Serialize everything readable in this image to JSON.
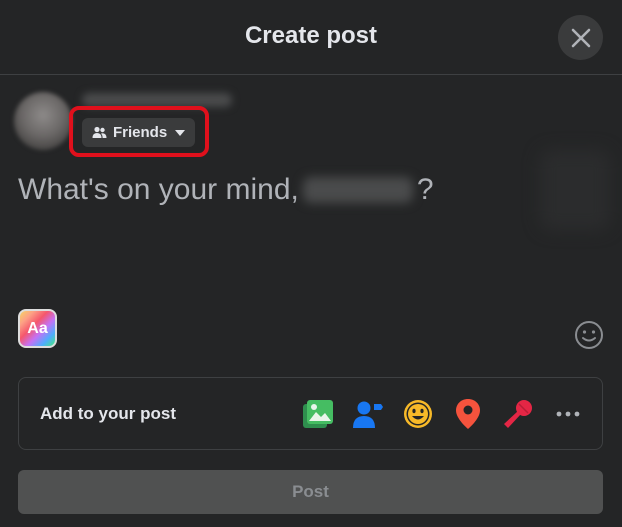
{
  "dialog": {
    "title": "Create post"
  },
  "audience": {
    "label": "Friends"
  },
  "composer": {
    "prompt_before": "What's on your mind,",
    "prompt_after": "?"
  },
  "text_format": {
    "label": "Aa"
  },
  "add_to_post": {
    "label": "Add to your post",
    "tools": [
      {
        "icon": "photo-video-icon",
        "color": "#45bd62"
      },
      {
        "icon": "tag-people-icon",
        "color": "#1877f2"
      },
      {
        "icon": "feeling-activity-icon",
        "color": "#f7b928"
      },
      {
        "icon": "check-in-icon",
        "color": "#f5533d"
      },
      {
        "icon": "live-video-icon",
        "color": "#e42645"
      },
      {
        "icon": "more-icon",
        "color": "#b0b3b8"
      }
    ]
  },
  "post_button": {
    "label": "Post"
  },
  "colors": {
    "background": "#242526",
    "highlight": "#e0101c",
    "button_disabled": "#505151"
  }
}
